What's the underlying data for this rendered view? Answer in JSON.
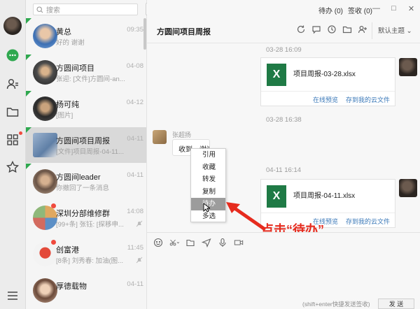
{
  "search": {
    "placeholder": "搜索"
  },
  "topbar": {
    "todo": "待办 (0)",
    "signin": "签收 (0)",
    "minimize": "—",
    "maximize": "□",
    "close": "✕"
  },
  "conversations": [
    {
      "name": "黄总",
      "preview": "好的 谢谢",
      "time": "09:35"
    },
    {
      "name": "方圆间项目",
      "preview": "张迎: [文件]方圆间-an...",
      "time": "04-08"
    },
    {
      "name": "杨可纯",
      "preview": "[图片]",
      "time": "04-12"
    },
    {
      "name": "方圆间项目周报",
      "preview": "[文件]项目周报-04-11...",
      "time": "04-11"
    },
    {
      "name": "方圆间leader",
      "preview": "你撤回了一条消息",
      "time": "04-11"
    },
    {
      "name": "深圳分部维修群",
      "preview": "[99+条] 张钰: [探移申...",
      "time": "14:08"
    },
    {
      "name": "创富港",
      "preview": "[8条] 刘秀春: 加油(图...",
      "time": "11:45"
    },
    {
      "name": "厚德载物",
      "preview": "",
      "time": "04-11"
    }
  ],
  "chat": {
    "title": "方圆间项目周报",
    "theme": "默认主题",
    "messages": [
      {
        "timestamp": "03-28 16:09",
        "file_icon": "X",
        "file_name": "项目周报-03-28.xlsx",
        "preview_link": "在线预览",
        "save_link": "存到我的云文件"
      },
      {
        "timestamp": "03-28 16:38",
        "sender": "张超扬",
        "text": "收到，谢谢"
      },
      {
        "timestamp": "04-11 16:14",
        "file_icon": "X",
        "file_name": "项目周报-04-11.xlsx",
        "preview_link": "在线预览",
        "save_link": "存到我的云文件"
      }
    ],
    "context_menu": [
      "引用",
      "收藏",
      "转发",
      "复制",
      "待办",
      "多选"
    ],
    "annotation": "点击“待办”",
    "input_hint": "(shift+enter快捷发送签收)",
    "send_label": "发 送"
  },
  "colors": {
    "accent_green": "#2fa84f",
    "excel_green": "#1f7a45",
    "link_blue": "#3a78b8",
    "annotation_red": "#e62b1e",
    "badge_red": "#f04a3e"
  }
}
